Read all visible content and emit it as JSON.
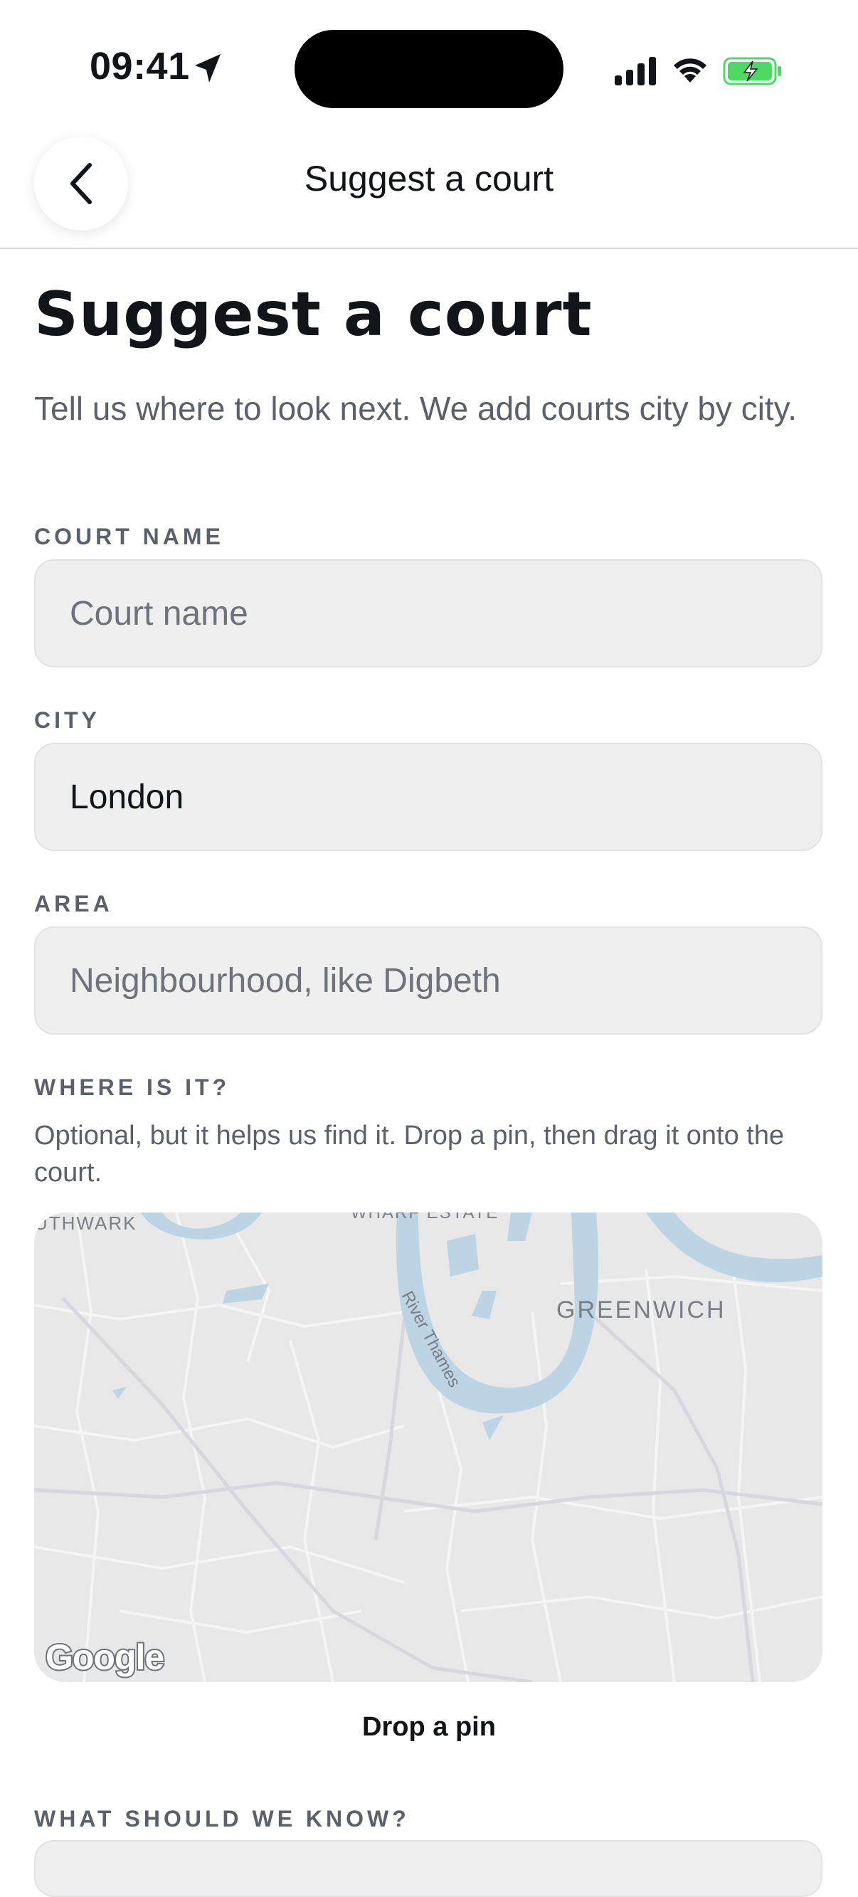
{
  "status_bar": {
    "time": "09:41"
  },
  "nav": {
    "title": "Suggest a court"
  },
  "page": {
    "title": "Suggest a court",
    "intro": "Tell us where to look next. We add courts city by city."
  },
  "form": {
    "court_name": {
      "label": "COURT NAME",
      "placeholder": "Court name",
      "value": ""
    },
    "city": {
      "label": "CITY",
      "value": "London"
    },
    "area": {
      "label": "AREA",
      "placeholder": "Neighbourhood, like Digbeth",
      "value": ""
    },
    "location": {
      "label": "WHERE IS IT?",
      "help": "Optional, but it helps us find it. Drop a pin, then drag it onto the court.",
      "map_labels": {
        "southwark": "UTHWARK",
        "wharf": "WHARF ESTATE",
        "river": "River Thames",
        "greenwich": "GREENWICH",
        "google": "Google"
      },
      "drop_pin_label": "Drop a pin"
    },
    "notes": {
      "label": "WHAT SHOULD WE KNOW?"
    }
  },
  "colors": {
    "accent": "#111418",
    "muted": "#5b616b",
    "field_bg": "#efefef",
    "water": "#bcd4e3",
    "battery": "#4cd964"
  },
  "icons": {
    "back": "chevron-left-icon",
    "location": "location-arrow-icon",
    "signal": "cellular-signal-icon",
    "wifi": "wifi-icon",
    "battery": "battery-charging-icon"
  }
}
